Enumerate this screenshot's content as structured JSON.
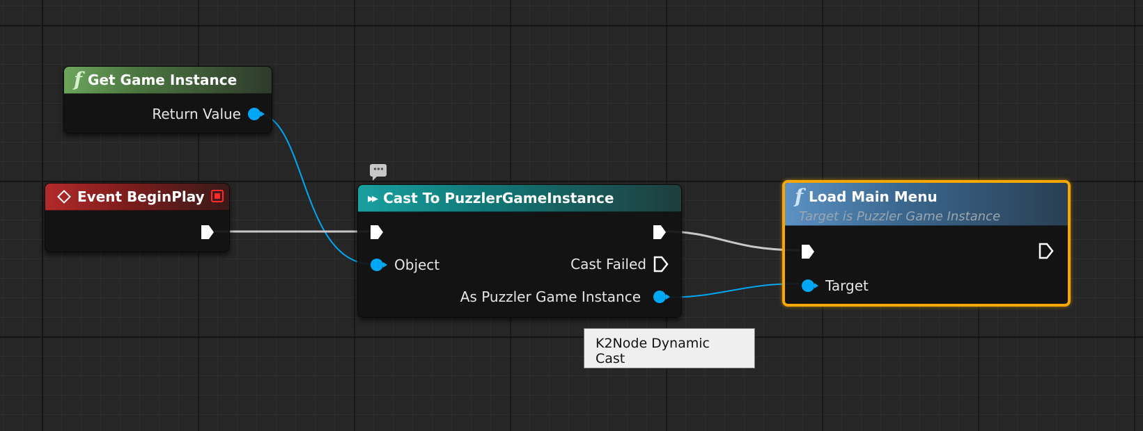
{
  "nodes": {
    "get_game_instance": {
      "title": "Get Game Instance",
      "icon": "function-icon",
      "pins": {
        "return_value": "Return Value"
      }
    },
    "event_begin_play": {
      "title": "Event BeginPlay",
      "icon": "event-icon"
    },
    "cast_to": {
      "title": "Cast To PuzzlerGameInstance",
      "icon": "cast-icon",
      "pins": {
        "object": "Object",
        "cast_failed": "Cast Failed",
        "as_instance": "As Puzzler Game Instance"
      }
    },
    "load_main_menu": {
      "title": "Load Main Menu",
      "subtitle": "Target is Puzzler Game Instance",
      "icon": "function-icon",
      "pins": {
        "target": "Target"
      }
    }
  },
  "tooltip": {
    "text": "K2Node Dynamic Cast"
  },
  "colors": {
    "exec_wire": "#c8c8c8",
    "object_wire": "#00a8f3",
    "selection": "#f7a800"
  }
}
